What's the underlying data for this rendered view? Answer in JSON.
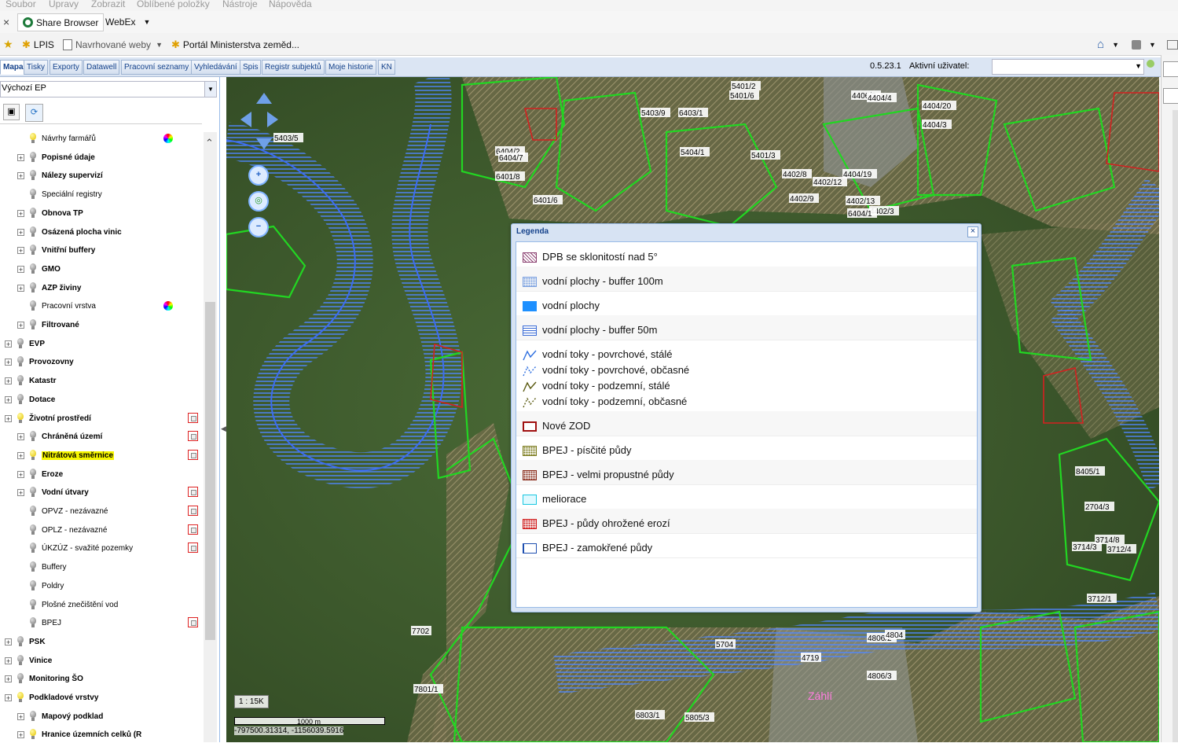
{
  "menubar": [
    "Soubor",
    "Úpravy",
    "Zobrazit",
    "Oblíbené položky",
    "Nástroje",
    "Nápověda"
  ],
  "tabbar": {
    "close": "×",
    "share_browser": "Share Browser",
    "webex": "WebEx"
  },
  "favorites": {
    "lpis": "LPIS",
    "suggested": "Navrhované weby",
    "portal": "Portál Ministerstva zeměd..."
  },
  "apptabs": [
    "Mapa",
    "Tisky",
    "Exporty",
    "Datawell",
    "Pracovní seznamy",
    "Vyhledávání",
    "Spis",
    "Registr subjektů",
    "Moje historie",
    "KN"
  ],
  "status": {
    "version": "0.5.23.1",
    "user_label": "Aktivní uživatel:",
    "user_value": ""
  },
  "layer_select": {
    "value": "Výchozí EP"
  },
  "tree": [
    {
      "label": "Návrhy farmářů",
      "bold": false,
      "plus": false,
      "bulb_on": true,
      "indent": 2,
      "icon": "color-wheel"
    },
    {
      "label": "Popisné údaje",
      "bold": true,
      "plus": true,
      "bulb_on": false,
      "indent": 2
    },
    {
      "label": "Nálezy supervizí",
      "bold": true,
      "plus": true,
      "bulb_on": false,
      "indent": 2
    },
    {
      "label": "Speciální registry",
      "bold": false,
      "plus": false,
      "bulb_on": false,
      "indent": 2
    },
    {
      "label": "Obnova TP",
      "bold": true,
      "plus": true,
      "bulb_on": false,
      "indent": 2
    },
    {
      "label": "Osázená plocha vinic",
      "bold": true,
      "plus": true,
      "bulb_on": false,
      "indent": 2
    },
    {
      "label": "Vnitřní buffery",
      "bold": true,
      "plus": true,
      "bulb_on": false,
      "indent": 2
    },
    {
      "label": "GMO",
      "bold": true,
      "plus": true,
      "bulb_on": false,
      "indent": 2
    },
    {
      "label": "AZP živiny",
      "bold": true,
      "plus": true,
      "bulb_on": false,
      "indent": 2
    },
    {
      "label": "Pracovní vrstva",
      "bold": false,
      "plus": false,
      "bulb_on": false,
      "indent": 2,
      "icon": "color-wheel"
    },
    {
      "label": "Filtrované",
      "bold": true,
      "plus": true,
      "bulb_on": false,
      "indent": 2
    },
    {
      "label": "EVP",
      "bold": true,
      "plus": true,
      "bulb_on": false,
      "indent": 1
    },
    {
      "label": "Provozovny",
      "bold": true,
      "plus": true,
      "bulb_on": false,
      "indent": 1
    },
    {
      "label": "Katastr",
      "bold": true,
      "plus": true,
      "bulb_on": false,
      "indent": 1
    },
    {
      "label": "Dotace",
      "bold": true,
      "plus": true,
      "bulb_on": false,
      "indent": 1
    },
    {
      "label": "Životní prostředí",
      "bold": true,
      "plus": true,
      "bulb_on": true,
      "indent": 1,
      "icon": "legend"
    },
    {
      "label": "Chráněná území",
      "bold": true,
      "plus": true,
      "bulb_on": false,
      "indent": 2,
      "icon": "legend"
    },
    {
      "label": "Nitrátová směrnice",
      "bold": true,
      "plus": true,
      "bulb_on": true,
      "indent": 2,
      "icon": "legend",
      "highlight": true
    },
    {
      "label": "Eroze",
      "bold": true,
      "plus": true,
      "bulb_on": false,
      "indent": 2
    },
    {
      "label": "Vodní útvary",
      "bold": true,
      "plus": true,
      "bulb_on": false,
      "indent": 2,
      "icon": "legend"
    },
    {
      "label": "OPVZ - nezávazné",
      "bold": false,
      "plus": false,
      "bulb_on": false,
      "indent": 2,
      "icon": "legend"
    },
    {
      "label": "OPLZ - nezávazné",
      "bold": false,
      "plus": false,
      "bulb_on": false,
      "indent": 2,
      "icon": "legend"
    },
    {
      "label": "ÚKZÚZ - svažité pozemky",
      "bold": false,
      "plus": false,
      "bulb_on": false,
      "indent": 2,
      "icon": "legend"
    },
    {
      "label": "Buffery",
      "bold": false,
      "plus": false,
      "bulb_on": false,
      "indent": 2
    },
    {
      "label": "Poldry",
      "bold": false,
      "plus": false,
      "bulb_on": false,
      "indent": 2
    },
    {
      "label": "Plošné znečištění vod",
      "bold": false,
      "plus": false,
      "bulb_on": false,
      "indent": 2
    },
    {
      "label": "BPEJ",
      "bold": false,
      "plus": false,
      "bulb_on": false,
      "indent": 2,
      "icon": "legend"
    },
    {
      "label": "PSK",
      "bold": true,
      "plus": true,
      "bulb_on": false,
      "indent": 1
    },
    {
      "label": "Vinice",
      "bold": true,
      "plus": true,
      "bulb_on": false,
      "indent": 1
    },
    {
      "label": "Monitoring ŠO",
      "bold": true,
      "plus": true,
      "bulb_on": false,
      "indent": 1
    },
    {
      "label": "Podkladové vrstvy",
      "bold": true,
      "plus": true,
      "bulb_on": true,
      "indent": 1
    },
    {
      "label": "Mapový podklad",
      "bold": true,
      "plus": true,
      "bulb_on": false,
      "indent": 2
    },
    {
      "label": "Hranice územních celků (R",
      "bold": true,
      "plus": true,
      "bulb_on": true,
      "indent": 2
    }
  ],
  "legend": {
    "title": "Legenda",
    "close": "×",
    "rows": [
      {
        "lines": [
          "DPB se sklonitostí nad 5°"
        ],
        "swatch": "hatch-purple"
      },
      {
        "lines": [
          "vodní plochy - buffer 100m"
        ],
        "swatch": "dots-blue"
      },
      {
        "lines": [
          "vodní plochy"
        ],
        "swatch": "solid-blue"
      },
      {
        "lines": [
          "vodní plochy - buffer 50m"
        ],
        "swatch": "lines-blue"
      },
      {
        "lines": [
          "vodní toky - povrchové, stálé",
          "vodní toky - povrchové, občasné",
          "vodní toky - podzemní, stálé",
          "vodní toky - podzemní, občasné"
        ],
        "swatch": "streams"
      },
      {
        "lines": [
          "Nové ZOD"
        ],
        "swatch": "red-box"
      },
      {
        "lines": [
          "BPEJ - písčité půdy"
        ],
        "swatch": "dots-olive"
      },
      {
        "lines": [
          "BPEJ - velmi propustné půdy"
        ],
        "swatch": "dots-brown"
      },
      {
        "lines": [
          "meliorace"
        ],
        "swatch": "cyan-box"
      },
      {
        "lines": [
          "BPEJ - půdy ohrožené erozí"
        ],
        "swatch": "dots-red"
      },
      {
        "lines": [
          "BPEJ - zamokřené půdy"
        ],
        "swatch": "blue-grid"
      }
    ]
  },
  "map": {
    "scale_ratio": "1 : 15K",
    "scale_bar": "1000 m",
    "coords": "-797500.31314, -1156039.5916",
    "parcel_labels": [
      "5401/2",
      "5401/6",
      "4406/3",
      "4404/4",
      "4404/20",
      "4404/3",
      "5403/9",
      "6403/1",
      "5404/1",
      "5401/3",
      "4402/8",
      "4404/19",
      "4402/12",
      "4402/9",
      "4402/13",
      "4402/3",
      "6404/1",
      "6404/2",
      "6404/7",
      "6401/8",
      "6401/6",
      "5403/5",
      "8405/1",
      "2704/3",
      "3714/3",
      "3714/8",
      "3712/4",
      "3712/1",
      "7702",
      "6803/1",
      "5805/3",
      "4719",
      "4806/2",
      "4806/3",
      "4804",
      "5704",
      "7801/1"
    ],
    "place_label": "Záhlí"
  },
  "colors": {
    "accent": "#15428b",
    "highlight": "#f6f600",
    "map_green": "#22d622",
    "map_blue": "#2f6bff"
  }
}
